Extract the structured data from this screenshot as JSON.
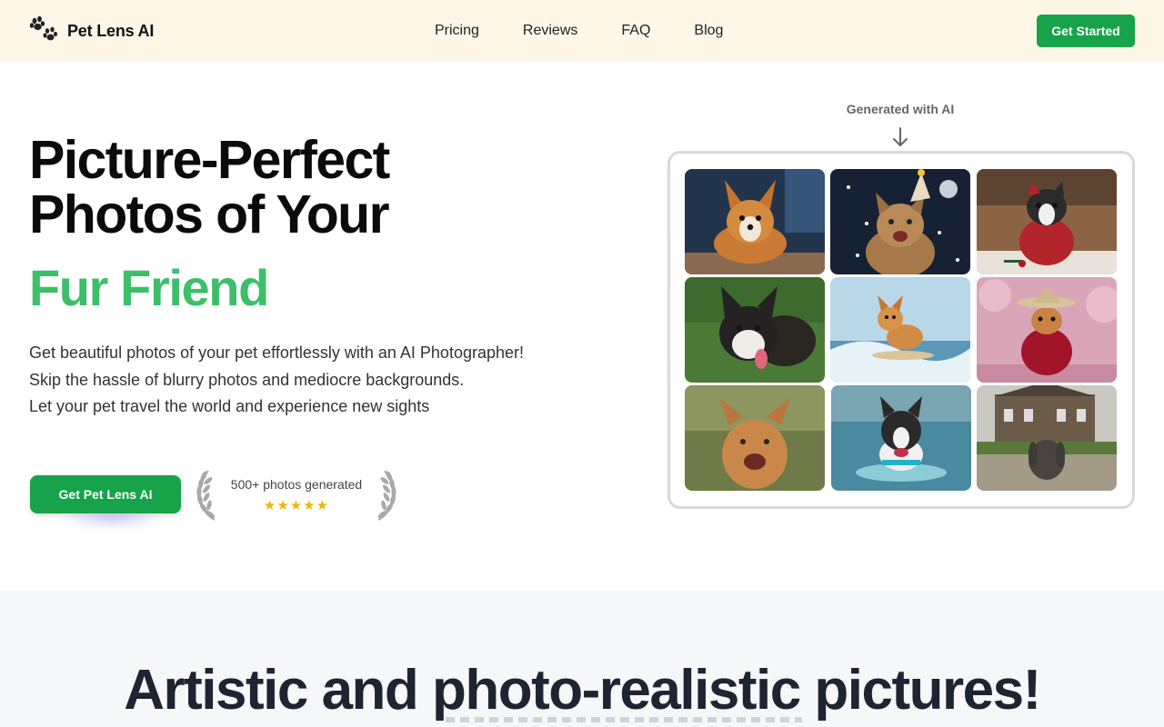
{
  "brand": {
    "name": "Pet Lens AI",
    "logo_icon": "paw-prints-icon"
  },
  "nav": {
    "items": [
      {
        "label": "Pricing"
      },
      {
        "label": "Reviews"
      },
      {
        "label": "FAQ"
      },
      {
        "label": "Blog"
      }
    ],
    "cta_label": "Get Started"
  },
  "hero": {
    "title_line1": "Picture-Perfect",
    "title_line2": "Photos of Your",
    "accent": "Fur Friend",
    "desc_line1": "Get beautiful photos of your pet effortlessly with an AI Photographer!",
    "desc_line2": "Skip the hassle of blurry photos and mediocre backgrounds.",
    "desc_line3": "Let your pet travel the world and experience new sights",
    "cta_label": "Get Pet Lens AI",
    "badge_text": "500+ photos generated",
    "rating_stars": 5,
    "stars": "★★★★★"
  },
  "gallery": {
    "label": "Generated with AI",
    "arrow_icon": "arrow-down-icon",
    "images": [
      {
        "subject": "corgi-photo"
      },
      {
        "subject": "cat-party-hat-photo"
      },
      {
        "subject": "boston-terrier-sweater-photo"
      },
      {
        "subject": "shiba-puppy-grass-photo"
      },
      {
        "subject": "corgi-surfing-photo"
      },
      {
        "subject": "dog-kimono-hat-photo"
      },
      {
        "subject": "orange-kitten-photo"
      },
      {
        "subject": "boston-terrier-swimming-photo"
      },
      {
        "subject": "bunny-mansion-photo"
      }
    ]
  },
  "section2": {
    "title": "Artistic and photo-realistic pictures!"
  },
  "colors": {
    "header_bg": "#fef7e8",
    "brand_green": "#16a34a",
    "accent_green": "#3dbf6a",
    "star_gold": "#f2b705",
    "section_bg": "#f6f7f9"
  }
}
